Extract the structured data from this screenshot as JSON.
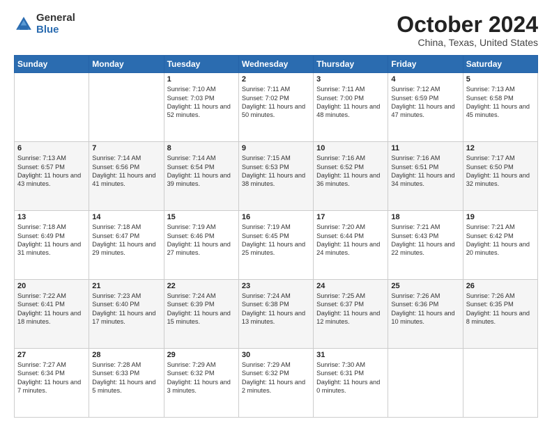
{
  "logo": {
    "general": "General",
    "blue": "Blue"
  },
  "title": {
    "month": "October 2024",
    "location": "China, Texas, United States"
  },
  "weekdays": [
    "Sunday",
    "Monday",
    "Tuesday",
    "Wednesday",
    "Thursday",
    "Friday",
    "Saturday"
  ],
  "weeks": [
    [
      {
        "day": "",
        "sunrise": "",
        "sunset": "",
        "daylight": ""
      },
      {
        "day": "",
        "sunrise": "",
        "sunset": "",
        "daylight": ""
      },
      {
        "day": "1",
        "sunrise": "Sunrise: 7:10 AM",
        "sunset": "Sunset: 7:03 PM",
        "daylight": "Daylight: 11 hours and 52 minutes."
      },
      {
        "day": "2",
        "sunrise": "Sunrise: 7:11 AM",
        "sunset": "Sunset: 7:02 PM",
        "daylight": "Daylight: 11 hours and 50 minutes."
      },
      {
        "day": "3",
        "sunrise": "Sunrise: 7:11 AM",
        "sunset": "Sunset: 7:00 PM",
        "daylight": "Daylight: 11 hours and 48 minutes."
      },
      {
        "day": "4",
        "sunrise": "Sunrise: 7:12 AM",
        "sunset": "Sunset: 6:59 PM",
        "daylight": "Daylight: 11 hours and 47 minutes."
      },
      {
        "day": "5",
        "sunrise": "Sunrise: 7:13 AM",
        "sunset": "Sunset: 6:58 PM",
        "daylight": "Daylight: 11 hours and 45 minutes."
      }
    ],
    [
      {
        "day": "6",
        "sunrise": "Sunrise: 7:13 AM",
        "sunset": "Sunset: 6:57 PM",
        "daylight": "Daylight: 11 hours and 43 minutes."
      },
      {
        "day": "7",
        "sunrise": "Sunrise: 7:14 AM",
        "sunset": "Sunset: 6:56 PM",
        "daylight": "Daylight: 11 hours and 41 minutes."
      },
      {
        "day": "8",
        "sunrise": "Sunrise: 7:14 AM",
        "sunset": "Sunset: 6:54 PM",
        "daylight": "Daylight: 11 hours and 39 minutes."
      },
      {
        "day": "9",
        "sunrise": "Sunrise: 7:15 AM",
        "sunset": "Sunset: 6:53 PM",
        "daylight": "Daylight: 11 hours and 38 minutes."
      },
      {
        "day": "10",
        "sunrise": "Sunrise: 7:16 AM",
        "sunset": "Sunset: 6:52 PM",
        "daylight": "Daylight: 11 hours and 36 minutes."
      },
      {
        "day": "11",
        "sunrise": "Sunrise: 7:16 AM",
        "sunset": "Sunset: 6:51 PM",
        "daylight": "Daylight: 11 hours and 34 minutes."
      },
      {
        "day": "12",
        "sunrise": "Sunrise: 7:17 AM",
        "sunset": "Sunset: 6:50 PM",
        "daylight": "Daylight: 11 hours and 32 minutes."
      }
    ],
    [
      {
        "day": "13",
        "sunrise": "Sunrise: 7:18 AM",
        "sunset": "Sunset: 6:49 PM",
        "daylight": "Daylight: 11 hours and 31 minutes."
      },
      {
        "day": "14",
        "sunrise": "Sunrise: 7:18 AM",
        "sunset": "Sunset: 6:47 PM",
        "daylight": "Daylight: 11 hours and 29 minutes."
      },
      {
        "day": "15",
        "sunrise": "Sunrise: 7:19 AM",
        "sunset": "Sunset: 6:46 PM",
        "daylight": "Daylight: 11 hours and 27 minutes."
      },
      {
        "day": "16",
        "sunrise": "Sunrise: 7:19 AM",
        "sunset": "Sunset: 6:45 PM",
        "daylight": "Daylight: 11 hours and 25 minutes."
      },
      {
        "day": "17",
        "sunrise": "Sunrise: 7:20 AM",
        "sunset": "Sunset: 6:44 PM",
        "daylight": "Daylight: 11 hours and 24 minutes."
      },
      {
        "day": "18",
        "sunrise": "Sunrise: 7:21 AM",
        "sunset": "Sunset: 6:43 PM",
        "daylight": "Daylight: 11 hours and 22 minutes."
      },
      {
        "day": "19",
        "sunrise": "Sunrise: 7:21 AM",
        "sunset": "Sunset: 6:42 PM",
        "daylight": "Daylight: 11 hours and 20 minutes."
      }
    ],
    [
      {
        "day": "20",
        "sunrise": "Sunrise: 7:22 AM",
        "sunset": "Sunset: 6:41 PM",
        "daylight": "Daylight: 11 hours and 18 minutes."
      },
      {
        "day": "21",
        "sunrise": "Sunrise: 7:23 AM",
        "sunset": "Sunset: 6:40 PM",
        "daylight": "Daylight: 11 hours and 17 minutes."
      },
      {
        "day": "22",
        "sunrise": "Sunrise: 7:24 AM",
        "sunset": "Sunset: 6:39 PM",
        "daylight": "Daylight: 11 hours and 15 minutes."
      },
      {
        "day": "23",
        "sunrise": "Sunrise: 7:24 AM",
        "sunset": "Sunset: 6:38 PM",
        "daylight": "Daylight: 11 hours and 13 minutes."
      },
      {
        "day": "24",
        "sunrise": "Sunrise: 7:25 AM",
        "sunset": "Sunset: 6:37 PM",
        "daylight": "Daylight: 11 hours and 12 minutes."
      },
      {
        "day": "25",
        "sunrise": "Sunrise: 7:26 AM",
        "sunset": "Sunset: 6:36 PM",
        "daylight": "Daylight: 11 hours and 10 minutes."
      },
      {
        "day": "26",
        "sunrise": "Sunrise: 7:26 AM",
        "sunset": "Sunset: 6:35 PM",
        "daylight": "Daylight: 11 hours and 8 minutes."
      }
    ],
    [
      {
        "day": "27",
        "sunrise": "Sunrise: 7:27 AM",
        "sunset": "Sunset: 6:34 PM",
        "daylight": "Daylight: 11 hours and 7 minutes."
      },
      {
        "day": "28",
        "sunrise": "Sunrise: 7:28 AM",
        "sunset": "Sunset: 6:33 PM",
        "daylight": "Daylight: 11 hours and 5 minutes."
      },
      {
        "day": "29",
        "sunrise": "Sunrise: 7:29 AM",
        "sunset": "Sunset: 6:32 PM",
        "daylight": "Daylight: 11 hours and 3 minutes."
      },
      {
        "day": "30",
        "sunrise": "Sunrise: 7:29 AM",
        "sunset": "Sunset: 6:32 PM",
        "daylight": "Daylight: 11 hours and 2 minutes."
      },
      {
        "day": "31",
        "sunrise": "Sunrise: 7:30 AM",
        "sunset": "Sunset: 6:31 PM",
        "daylight": "Daylight: 11 hours and 0 minutes."
      },
      {
        "day": "",
        "sunrise": "",
        "sunset": "",
        "daylight": ""
      },
      {
        "day": "",
        "sunrise": "",
        "sunset": "",
        "daylight": ""
      }
    ]
  ]
}
